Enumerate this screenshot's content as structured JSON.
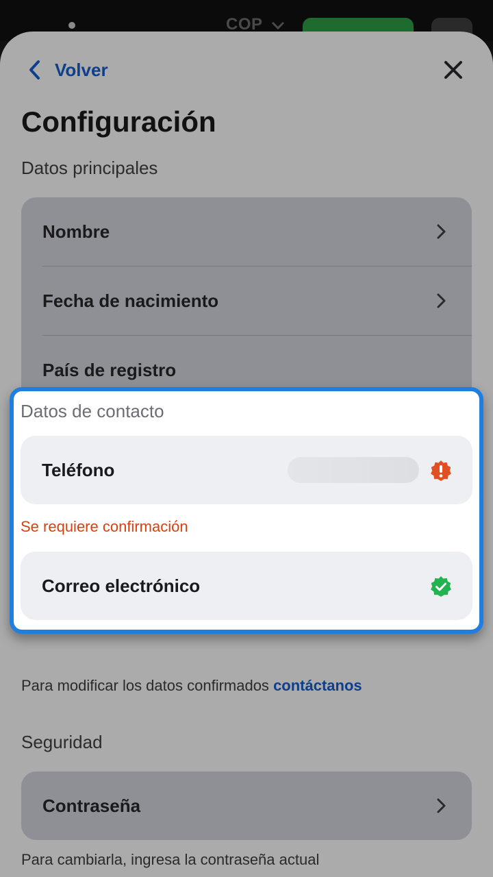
{
  "topbar": {
    "currency": "COP"
  },
  "nav": {
    "back_label": "Volver"
  },
  "page": {
    "title": "Configuración"
  },
  "main_section": {
    "label": "Datos principales",
    "items": [
      {
        "label": "Nombre"
      },
      {
        "label": "Fecha de nacimiento"
      },
      {
        "label": "País de registro"
      }
    ]
  },
  "contact_section": {
    "label": "Datos de contacto",
    "phone_label": "Teléfono",
    "phone_warning": "Se requiere confirmación",
    "email_label": "Correo electrónico",
    "footer_text": "Para modificar los datos confirmados",
    "footer_link": "contáctanos"
  },
  "security_section": {
    "label": "Seguridad",
    "password_label": "Contraseña",
    "password_hint": "Para cambiarla, ingresa la contraseña actual"
  },
  "colors": {
    "accent": "#0d3f8c",
    "highlight": "#1f7ee0",
    "warning": "#e05024",
    "success": "#21b350"
  },
  "icons": {
    "back": "chevron-left-icon",
    "close": "close-icon",
    "row": "chevron-right-icon",
    "phone_status": "warning-badge-icon",
    "email_status": "verified-badge-icon"
  }
}
